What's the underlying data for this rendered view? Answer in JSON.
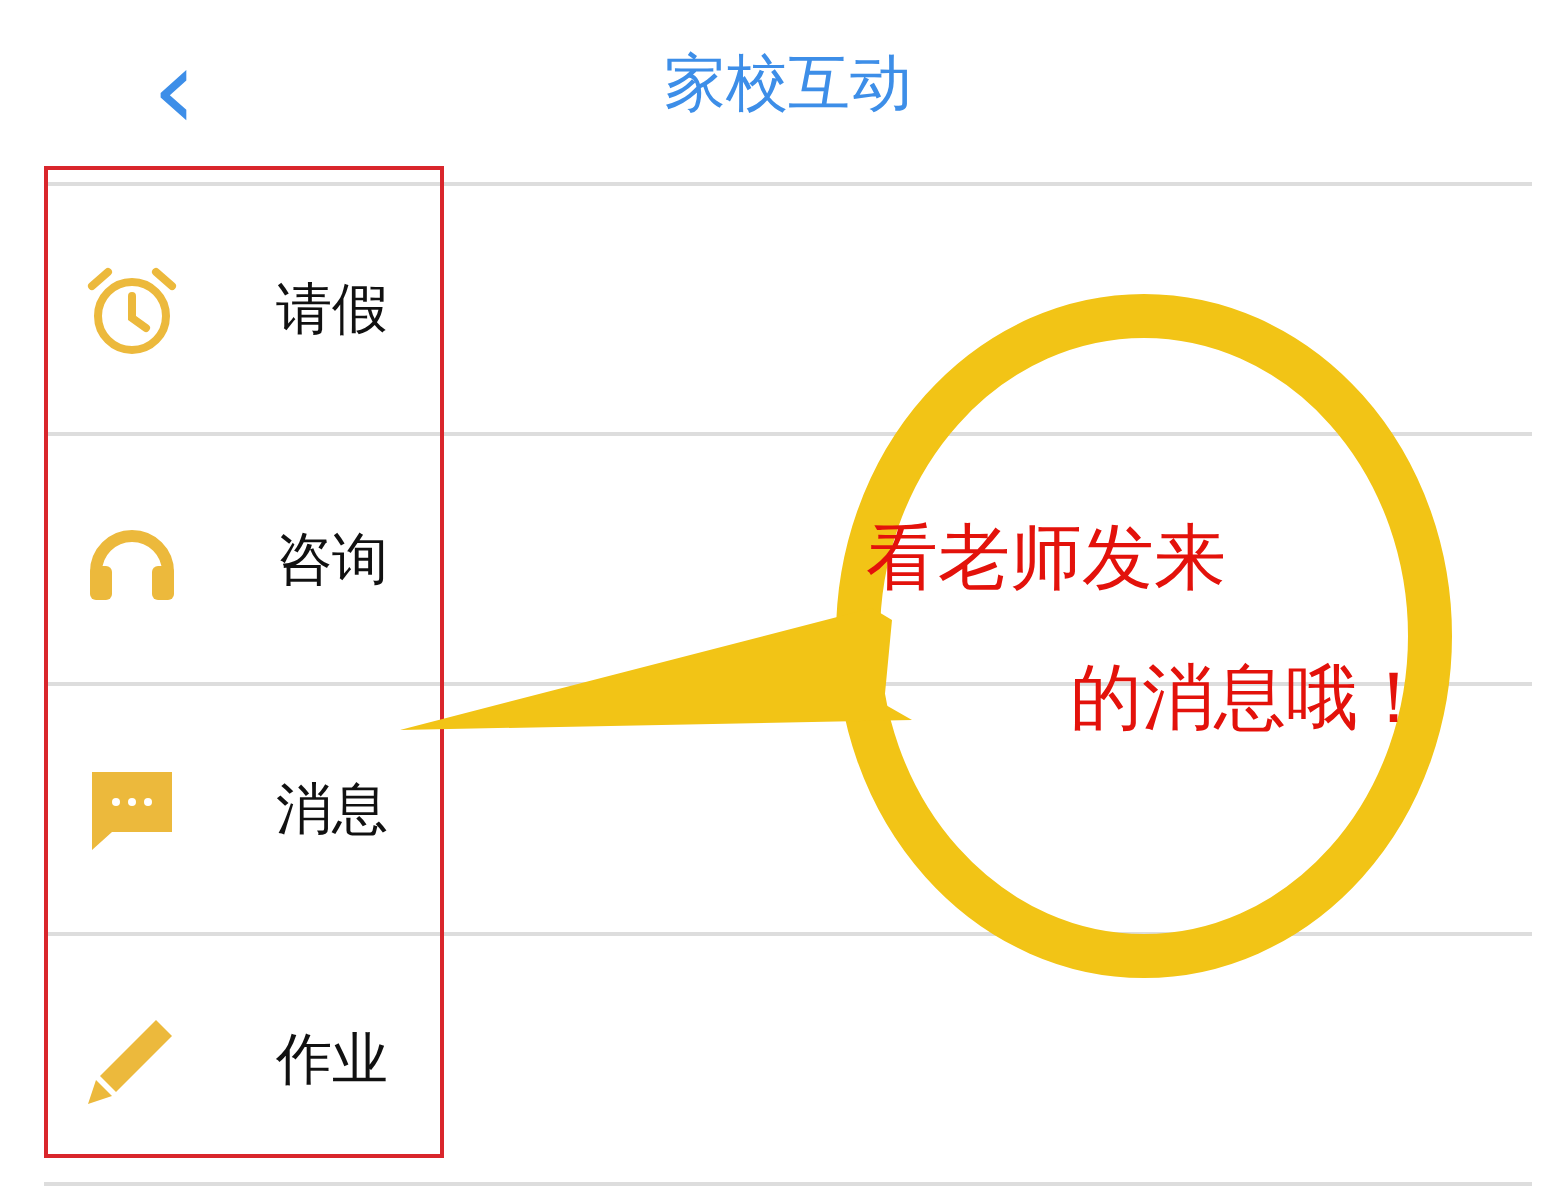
{
  "header": {
    "back": "‹",
    "title": "家校互动"
  },
  "menu": [
    {
      "label": "请假"
    },
    {
      "label": "咨询"
    },
    {
      "label": "消息"
    },
    {
      "label": "作业"
    }
  ],
  "callout": {
    "lines": [
      "看老师发来",
      "的消息哦！"
    ]
  }
}
